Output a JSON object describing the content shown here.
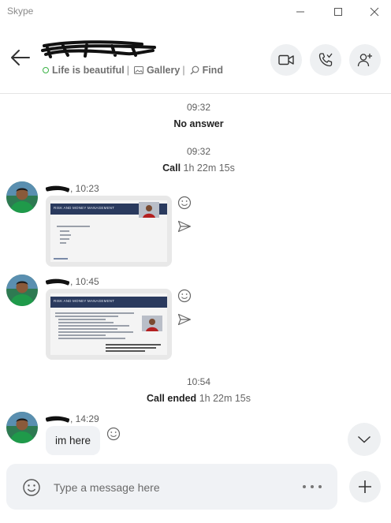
{
  "app": {
    "title": "Skype"
  },
  "header": {
    "mood": "Life is beautiful",
    "separator": "|",
    "gallery_label": "Gallery",
    "find_label": "Find"
  },
  "chat": {
    "events": [
      {
        "time": "09:32",
        "label": "No answer",
        "duration": ""
      },
      {
        "time": "09:32",
        "label": "Call",
        "duration": "1h 22m 15s"
      },
      {
        "time": "10:54",
        "label": "Call ended",
        "duration": "1h 22m 15s"
      }
    ],
    "messages": [
      {
        "time": ", 10:23",
        "slide_title": "RISK AND MONEY MANAGEMENT"
      },
      {
        "time": ", 10:45",
        "slide_title": "RISK AND MONEY MANAGEMENT"
      },
      {
        "time": ", 14:29",
        "text": "im here"
      }
    ]
  },
  "composer": {
    "placeholder": "Type a message here"
  },
  "icons": {
    "status": "online-status-icon",
    "gallery": "gallery-icon",
    "find": "search-icon",
    "video": "video-call-icon",
    "call": "audio-call-icon",
    "add_people": "add-people-icon",
    "emoji": "emoji-icon",
    "forward": "forward-icon",
    "more": "more-icon",
    "plus": "plus-icon",
    "scroll": "chevron-down-icon"
  },
  "colors": {
    "online": "#3bb346",
    "bubble": "#f0f2f5",
    "slide_band": "#2a3a5e"
  }
}
